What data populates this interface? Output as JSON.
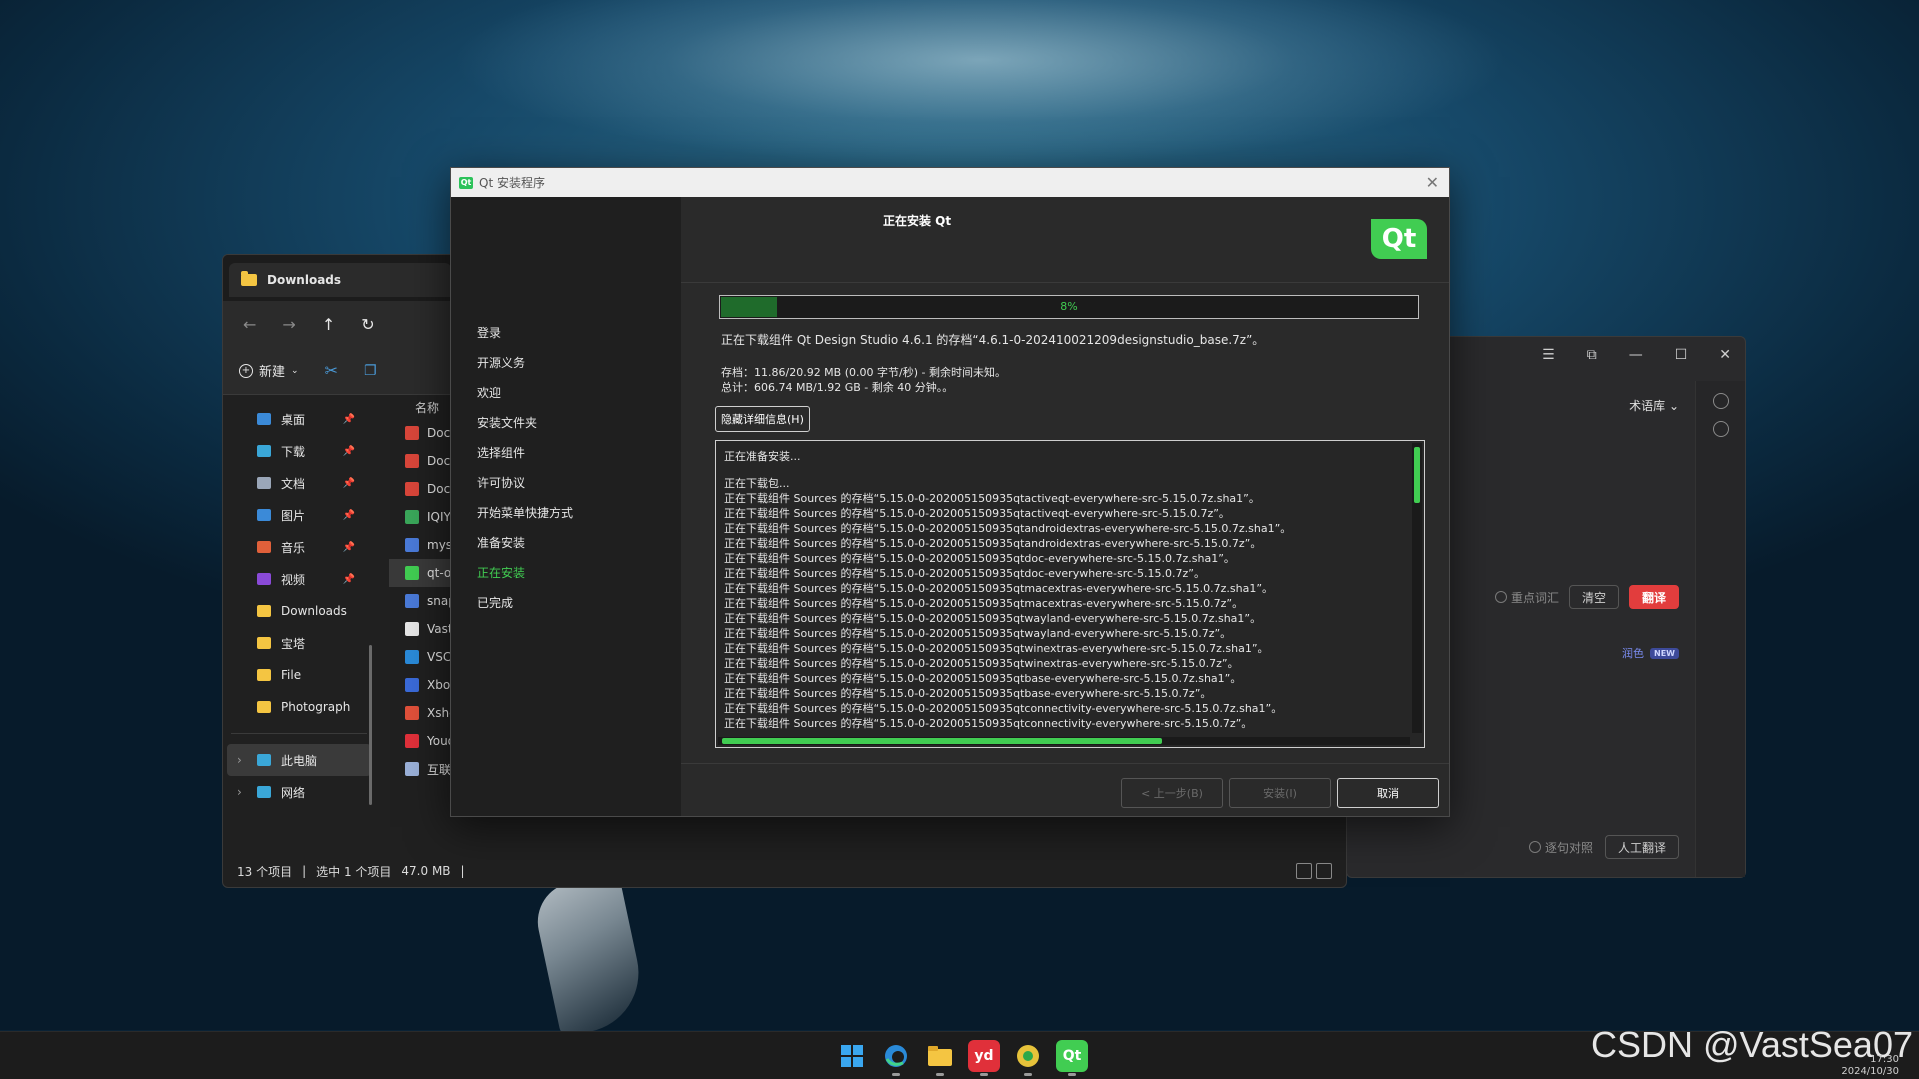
{
  "explorer": {
    "tab_title": "Downloads",
    "new_label": "新建",
    "column_name": "名称",
    "sidebar": [
      {
        "label": "桌面",
        "icon": "desktop-icon",
        "color": "#3b8ad8",
        "pinned": true
      },
      {
        "label": "下载",
        "icon": "download-icon",
        "color": "#3aa7d8",
        "pinned": true
      },
      {
        "label": "文档",
        "icon": "document-icon",
        "color": "#9aa6b8",
        "pinned": true
      },
      {
        "label": "图片",
        "icon": "picture-icon",
        "color": "#3b8ad8",
        "pinned": true
      },
      {
        "label": "音乐",
        "icon": "music-icon",
        "color": "#e0603a",
        "pinned": true
      },
      {
        "label": "视频",
        "icon": "video-icon",
        "color": "#8a4ad8",
        "pinned": true
      },
      {
        "label": "Downloads",
        "icon": "folder-icon",
        "color": "#f4c542",
        "pinned": false
      },
      {
        "label": "宝塔",
        "icon": "folder-icon",
        "color": "#f4c542",
        "pinned": false
      },
      {
        "label": "File",
        "icon": "folder-icon",
        "color": "#f4c542",
        "pinned": false
      },
      {
        "label": "Photograph",
        "icon": "folder-icon",
        "color": "#f4c542",
        "pinned": false
      }
    ],
    "this_pc": "此电脑",
    "network": "网络",
    "files": [
      {
        "name": "Docu",
        "icon": "pdf-icon",
        "color": "#d9463a"
      },
      {
        "name": "Docu",
        "icon": "pdf-icon",
        "color": "#d9463a"
      },
      {
        "name": "Docu",
        "icon": "pdf-icon",
        "color": "#d9463a"
      },
      {
        "name": "IQIYI",
        "icon": "image-icon",
        "color": "#3aa75a"
      },
      {
        "name": "mysc",
        "icon": "zip-icon",
        "color": "#4a7ad8"
      },
      {
        "name": "qt-or",
        "icon": "qt-icon",
        "color": "#41cd52"
      },
      {
        "name": "snap",
        "icon": "zip-icon",
        "color": "#4a7ad8"
      },
      {
        "name": "VastS",
        "icon": "text-file-icon",
        "color": "#e6e6e6"
      },
      {
        "name": "VSCo",
        "icon": "vscode-icon",
        "color": "#2a8ad8"
      },
      {
        "name": "Xbox",
        "icon": "xbox-installer-icon",
        "color": "#3a6ad8"
      },
      {
        "name": "Xshe",
        "icon": "xshell-icon",
        "color": "#e0503a"
      },
      {
        "name": "Youd",
        "icon": "youdao-icon",
        "color": "#e0303a"
      },
      {
        "name": "互联网",
        "icon": "text-file-icon",
        "color": "#9ab0d8"
      }
    ],
    "status": {
      "items": "13 个项目",
      "selected": "选中 1 个项目",
      "size": "47.0 MB"
    }
  },
  "translator": {
    "library": "术语库",
    "key_vocab": "重点词汇",
    "clear": "清空",
    "translate": "翻译",
    "polish": "润色",
    "new_badge": "NEW",
    "sentence_compare": "逐句对照",
    "human_translate": "人工翻译"
  },
  "installer": {
    "window_title": "Qt 安装程序",
    "page_title": "正在安装 Qt",
    "logo_text": "Qt",
    "steps": [
      "登录",
      "开源义务",
      "欢迎",
      "安装文件夹",
      "选择组件",
      "许可协议",
      "开始菜单快捷方式",
      "准备安装",
      "正在安装",
      "已完成"
    ],
    "active_step": 8,
    "progress_label": "8%",
    "progress_value": 0.08,
    "current_task": "正在下载组件 Qt Design Studio 4.6.1 的存档“4.6.1-0-202410021209designstudio_base.7z”。",
    "storage_line": "存档：11.86/20.92 MB (0.00 字节/秒) - 剩余时间未知。",
    "total_line": "总计：606.74 MB/1.92 GB - 剩余 40 分钟。。",
    "details_button": "隐藏详细信息(H)",
    "log": [
      "正在准备安装...",
      "",
      "正在下载包...",
      "正在下载组件 Sources 的存档“5.15.0-0-202005150935qtactiveqt-everywhere-src-5.15.0.7z.sha1”。",
      "正在下载组件 Sources 的存档“5.15.0-0-202005150935qtactiveqt-everywhere-src-5.15.0.7z”。",
      "正在下载组件 Sources 的存档“5.15.0-0-202005150935qtandroidextras-everywhere-src-5.15.0.7z.sha1”。",
      "正在下载组件 Sources 的存档“5.15.0-0-202005150935qtandroidextras-everywhere-src-5.15.0.7z”。",
      "正在下载组件 Sources 的存档“5.15.0-0-202005150935qtdoc-everywhere-src-5.15.0.7z.sha1”。",
      "正在下载组件 Sources 的存档“5.15.0-0-202005150935qtdoc-everywhere-src-5.15.0.7z”。",
      "正在下载组件 Sources 的存档“5.15.0-0-202005150935qtmacextras-everywhere-src-5.15.0.7z.sha1”。",
      "正在下载组件 Sources 的存档“5.15.0-0-202005150935qtmacextras-everywhere-src-5.15.0.7z”。",
      "正在下载组件 Sources 的存档“5.15.0-0-202005150935qtwayland-everywhere-src-5.15.0.7z.sha1”。",
      "正在下载组件 Sources 的存档“5.15.0-0-202005150935qtwayland-everywhere-src-5.15.0.7z”。",
      "正在下载组件 Sources 的存档“5.15.0-0-202005150935qtwinextras-everywhere-src-5.15.0.7z.sha1”。",
      "正在下载组件 Sources 的存档“5.15.0-0-202005150935qtwinextras-everywhere-src-5.15.0.7z”。",
      "正在下载组件 Sources 的存档“5.15.0-0-202005150935qtbase-everywhere-src-5.15.0.7z.sha1”。",
      "正在下载组件 Sources 的存档“5.15.0-0-202005150935qtbase-everywhere-src-5.15.0.7z”。",
      "正在下载组件 Sources 的存档“5.15.0-0-202005150935qtconnectivity-everywhere-src-5.15.0.7z.sha1”。",
      "正在下载组件 Sources 的存档“5.15.0-0-202005150935qtconnectivity-everywhere-src-5.15.0.7z”。"
    ],
    "back_button": "< 上一步(B)",
    "install_button": "安装(I)",
    "cancel_button": "取消",
    "accent": "#41cd52"
  },
  "taskbar": {
    "apps": [
      {
        "name": "start-icon",
        "label": "",
        "color": "#3aa7f0"
      },
      {
        "name": "edge-icon",
        "label": "",
        "color": "#2a8ad8"
      },
      {
        "name": "file-explorer-icon",
        "label": "",
        "color": "#f4c542"
      },
      {
        "name": "youdao-icon",
        "label": "yd",
        "color": "#e0303a"
      },
      {
        "name": "chrome-like-icon",
        "label": "",
        "color": "#e6c23a"
      },
      {
        "name": "qt-icon",
        "label": "Qt",
        "color": "#41cd52"
      }
    ],
    "watermark": "CSDN @VastSea07",
    "time": "17:30",
    "date": "2024/10/30"
  }
}
